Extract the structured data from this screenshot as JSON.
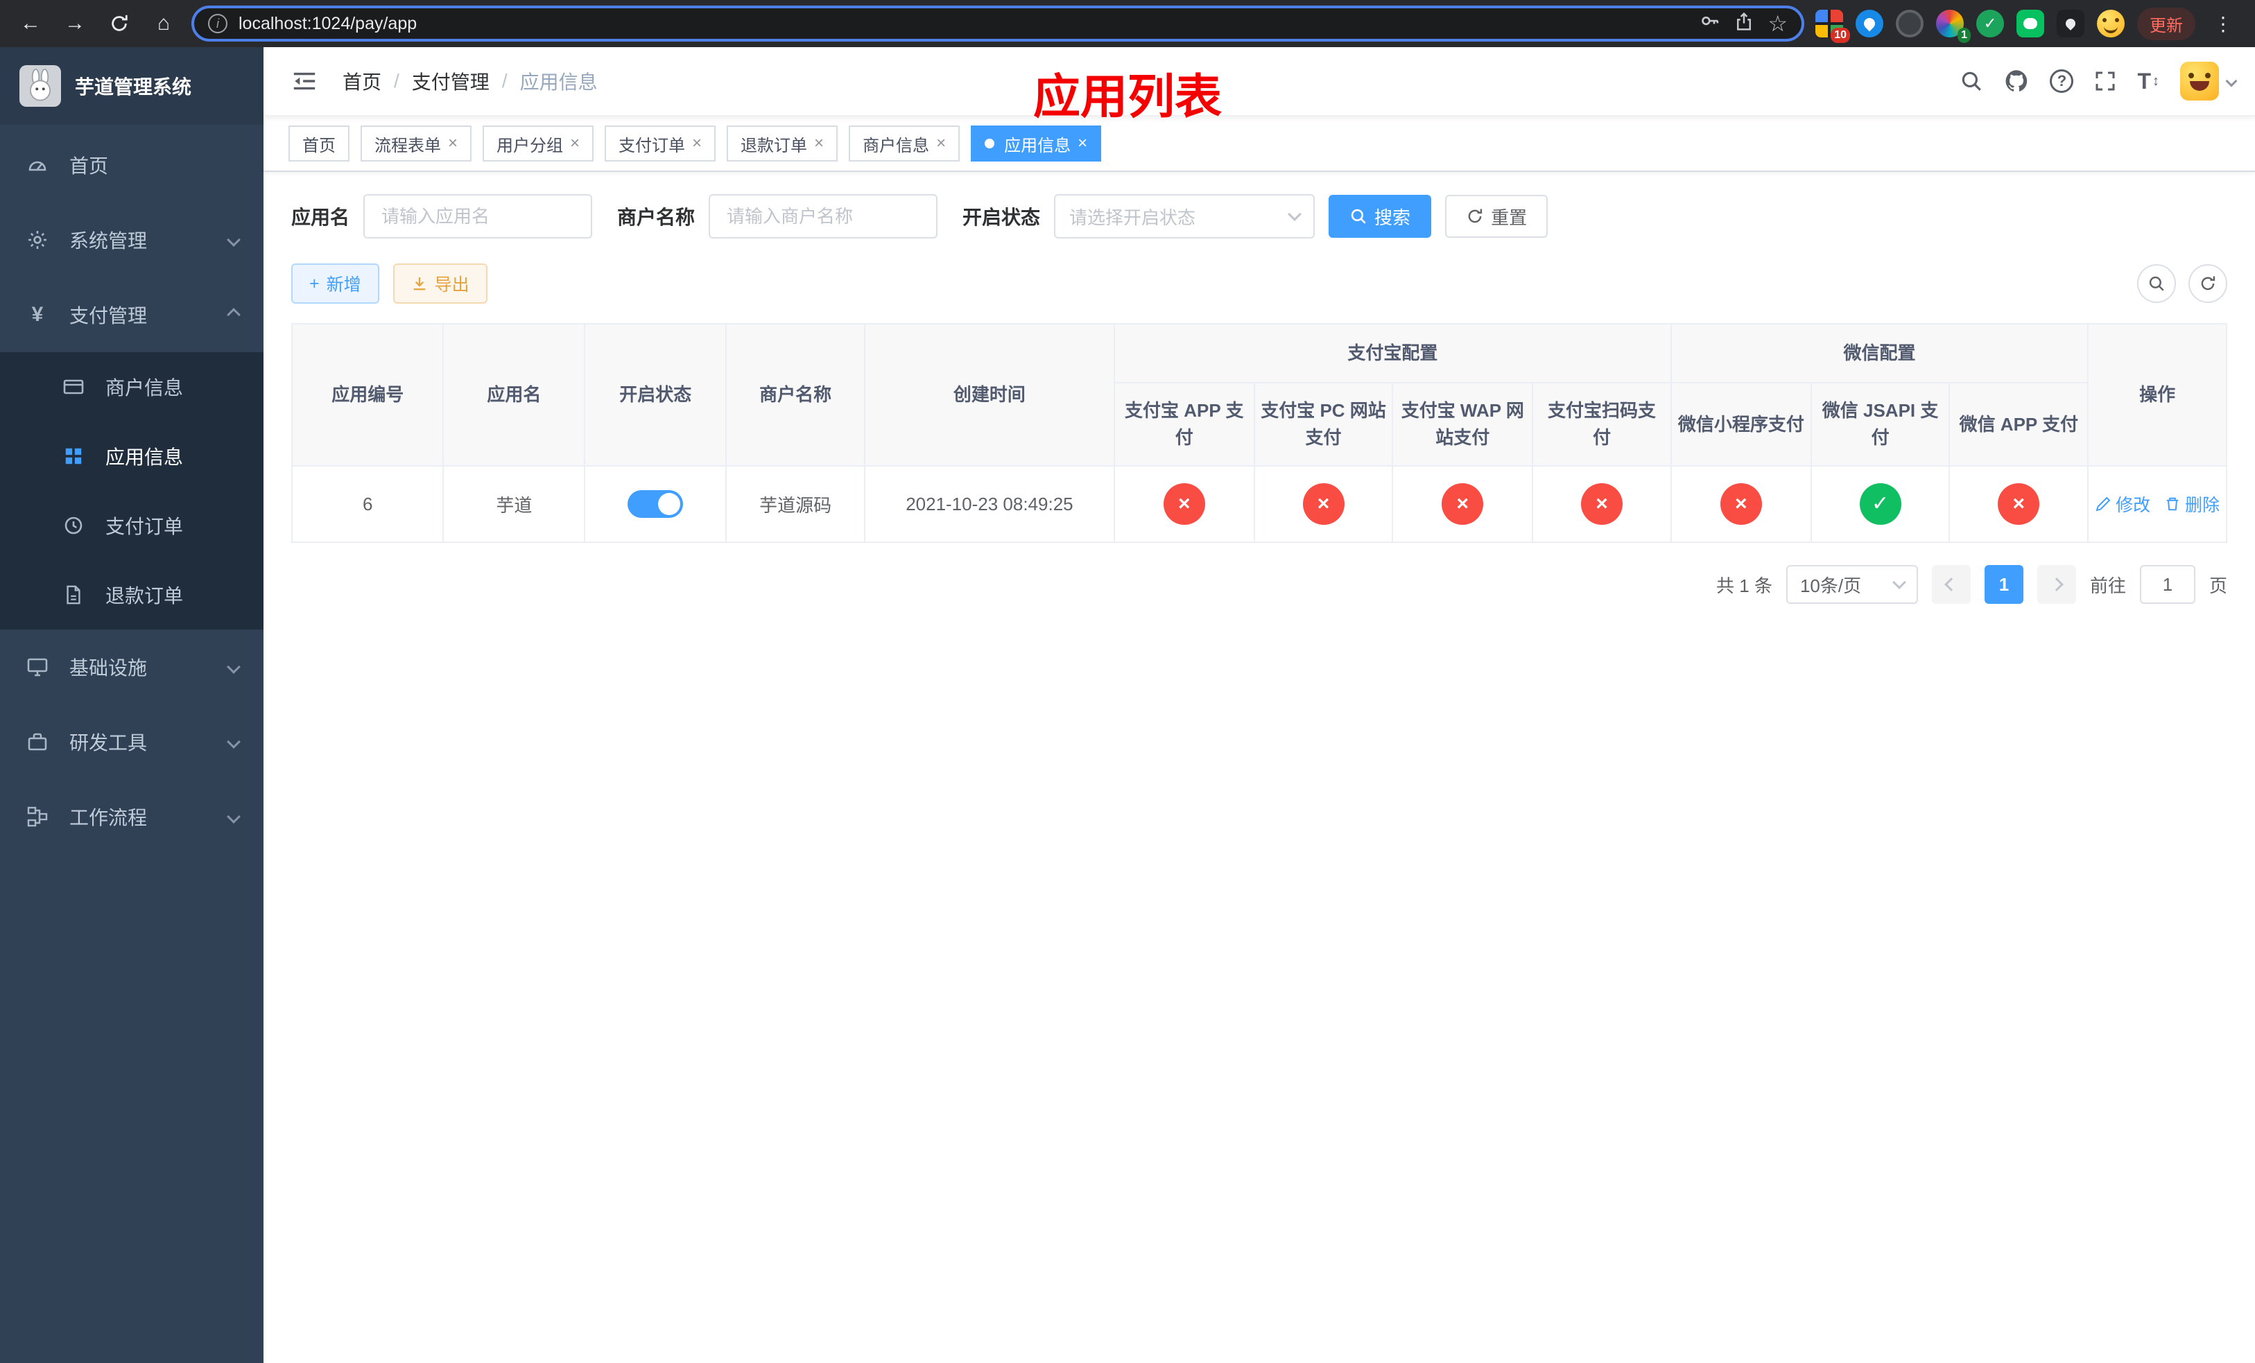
{
  "colors": {
    "accent": "#409eff",
    "danger": "#f94c43",
    "success": "#0fbf61",
    "warning": "#e6a23c",
    "annotation": "#f40000",
    "sidebar_bg": "#304156",
    "submenu_bg": "#1f2d3d"
  },
  "glyphs": {
    "back": "←",
    "forward": "→",
    "home": "⌂",
    "star": "☆",
    "dots": "⋮",
    "info": "i",
    "question": "?",
    "close": "×",
    "check": "✓",
    "plus": "+",
    "slash": "/",
    "yen": "¥",
    "text_size": "T",
    "updown": "↕"
  },
  "browser": {
    "url": "localhost:1024/pay/app",
    "update_label": "更新",
    "badge_a": "10",
    "badge_b": "1"
  },
  "sidebar": {
    "title": "芋道管理系统",
    "items": [
      {
        "label": "首页"
      },
      {
        "label": "系统管理"
      },
      {
        "label": "支付管理"
      },
      {
        "label": "商户信息"
      },
      {
        "label": "应用信息"
      },
      {
        "label": "支付订单"
      },
      {
        "label": "退款订单"
      },
      {
        "label": "基础设施"
      },
      {
        "label": "研发工具"
      },
      {
        "label": "工作流程"
      }
    ]
  },
  "header": {
    "breadcrumb": [
      {
        "label": "首页"
      },
      {
        "label": "支付管理"
      },
      {
        "label": "应用信息"
      }
    ],
    "annotation": "应用列表"
  },
  "tabs": [
    {
      "label": "首页"
    },
    {
      "label": "流程表单"
    },
    {
      "label": "用户分组"
    },
    {
      "label": "支付订单"
    },
    {
      "label": "退款订单"
    },
    {
      "label": "商户信息"
    },
    {
      "label": "应用信息"
    }
  ],
  "filters": {
    "app_name_label": "应用名",
    "app_name_placeholder": "请输入应用名",
    "merchant_label": "商户名称",
    "merchant_placeholder": "请输入商户名称",
    "status_label": "开启状态",
    "status_placeholder": "请选择开启状态",
    "search_label": "搜索",
    "reset_label": "重置"
  },
  "toolbar": {
    "add_label": "新增",
    "export_label": "导出"
  },
  "table": {
    "headers": {
      "app_id": "应用编号",
      "app_name": "应用名",
      "status": "开启状态",
      "merchant": "商户名称",
      "created": "创建时间",
      "alipay_group": "支付宝配置",
      "wechat_group": "微信配置",
      "alipay_app": "支付宝 APP 支付",
      "alipay_pc": "支付宝 PC 网站支付",
      "alipay_wap": "支付宝 WAP 网站支付",
      "alipay_qr": "支付宝扫码支付",
      "wx_mini": "微信小程序支付",
      "wx_jsapi": "微信 JSAPI 支付",
      "wx_app": "微信 APP 支付",
      "actions": "操作"
    },
    "row": {
      "id": "6",
      "name": "芋道",
      "status_on": true,
      "merchant": "芋道源码",
      "created": "2021-10-23 08:49:25",
      "configs": [
        {
          "name": "alipay-app-pay",
          "type": "danger",
          "glyph": "×"
        },
        {
          "name": "alipay-pc-pay",
          "type": "danger",
          "glyph": "×"
        },
        {
          "name": "alipay-wap-pay",
          "type": "danger",
          "glyph": "×"
        },
        {
          "name": "alipay-qr-pay",
          "type": "danger",
          "glyph": "×"
        },
        {
          "name": "wechat-mini-pay",
          "type": "danger",
          "glyph": "×"
        },
        {
          "name": "wechat-jsapi-pay",
          "type": "success",
          "glyph": "✓"
        },
        {
          "name": "wechat-app-pay",
          "type": "danger",
          "glyph": "×"
        }
      ],
      "edit_label": "修改",
      "delete_label": "删除"
    }
  },
  "pagination": {
    "total_text": "共 1 条",
    "page_size": "10条/页",
    "current_page": "1",
    "goto_prefix": "前往",
    "goto_value": "1",
    "goto_suffix": "页"
  }
}
